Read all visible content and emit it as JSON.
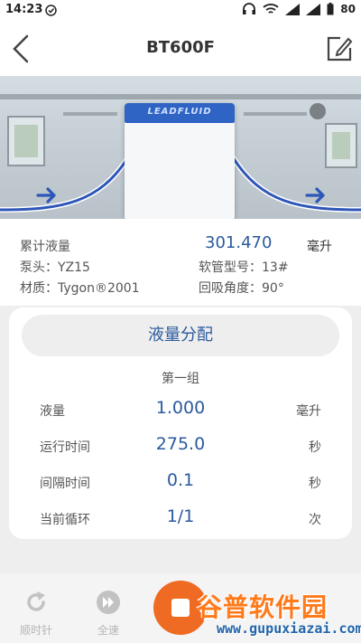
{
  "status_bar": {
    "time": "14:23",
    "battery": "80",
    "icons": [
      "clock-icon",
      "headset-icon",
      "wifi-icon",
      "signal-icon",
      "signal-icon"
    ]
  },
  "header": {
    "title": "BT600F",
    "back_icon": "chevron-left-icon",
    "edit_icon": "edit-icon"
  },
  "banner": {
    "brand": "LEADFLUID"
  },
  "info": {
    "total_label": "累计液量",
    "total_value": "301.470",
    "total_unit": "毫升",
    "pump_head": "泵头：YZ15",
    "tube_model": "软管型号：13#",
    "material": "材质：Tygon®2001",
    "suckback": "回吸角度：90°"
  },
  "card": {
    "button_label": "液量分配",
    "group_label": "第一组",
    "params": [
      {
        "label": "液量",
        "value": "1.000",
        "unit": "毫升"
      },
      {
        "label": "运行时间",
        "value": "275.0",
        "unit": "秒"
      },
      {
        "label": "间隔时间",
        "value": "0.1",
        "unit": "秒"
      },
      {
        "label": "当前循环",
        "value": "1/1",
        "unit": "次"
      }
    ]
  },
  "bottom_bar": {
    "clockwise_label": "顺时针",
    "fullspeed_label": "全速"
  },
  "watermark": {
    "cn": "谷普软件园",
    "en": "www.gupuxiazai.com"
  },
  "colors": {
    "accent_blue": "#2b5a9e",
    "stop_orange": "#ef6b23",
    "pump_blue": "#2f64c4"
  }
}
